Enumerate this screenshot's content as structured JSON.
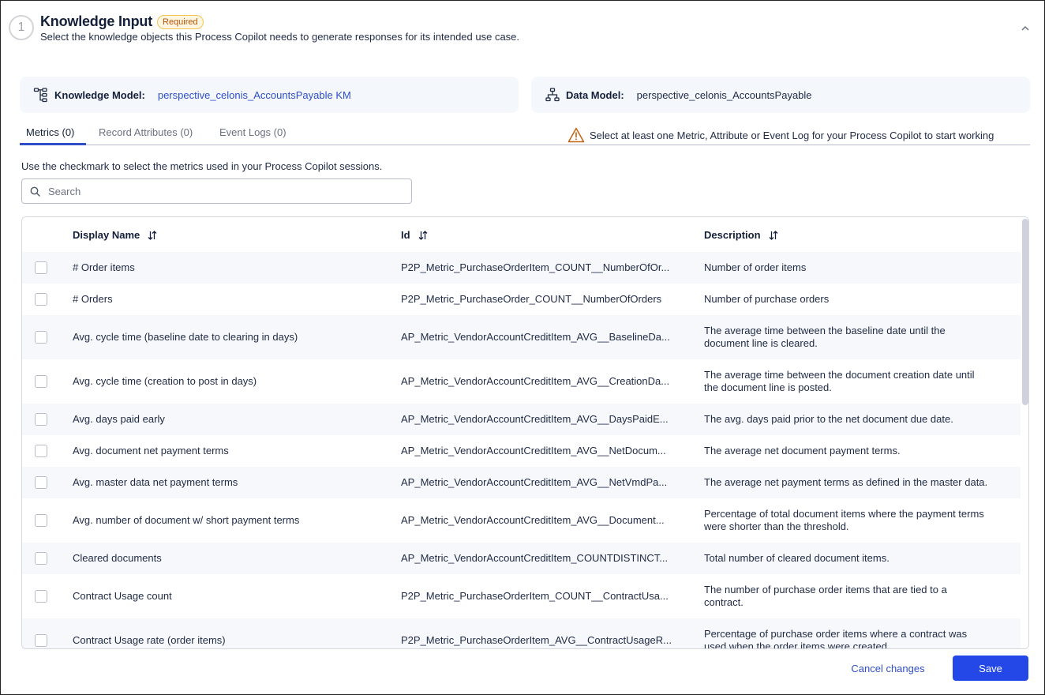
{
  "header": {
    "step_number": "1",
    "title": "Knowledge Input",
    "badge": "Required",
    "subtitle": "Select the knowledge objects this Process Copilot needs to generate responses for its intended use case."
  },
  "knowledge_model": {
    "icon": "hierarchy-tree-icon",
    "label": "Knowledge Model:",
    "value": "perspective_celonis_AccountsPayable KM"
  },
  "data_model": {
    "icon": "sitemap-icon",
    "label": "Data Model:",
    "value": "perspective_celonis_AccountsPayable"
  },
  "tabs": [
    {
      "label": "Metrics (0)",
      "active": true
    },
    {
      "label": "Record Attributes (0)",
      "active": false
    },
    {
      "label": "Event Logs (0)",
      "active": false
    }
  ],
  "warning": {
    "icon": "warning-triangle-icon",
    "text": "Select at least one Metric, Attribute or Event Log for your Process Copilot to start working"
  },
  "instruction": "Use the checkmark to select the metrics used in your Process Copilot sessions.",
  "search": {
    "placeholder": "Search",
    "value": ""
  },
  "table": {
    "columns": [
      "Display Name",
      "Id",
      "Description"
    ],
    "rows": [
      {
        "name": "# Order items",
        "id": "P2P_Metric_PurchaseOrderItem_COUNT__NumberOfOr...",
        "description": [
          "Number of order items"
        ],
        "checked": false
      },
      {
        "name": "# Orders",
        "id": "P2P_Metric_PurchaseOrder_COUNT__NumberOfOrders",
        "description": [
          "Number of purchase orders"
        ],
        "checked": false
      },
      {
        "name": "Avg. cycle time (baseline date to clearing in days)",
        "id": "AP_Metric_VendorAccountCreditItem_AVG__BaselineDa...",
        "description": [
          "The average time between the baseline date until the",
          "document line is cleared."
        ],
        "checked": false
      },
      {
        "name": "Avg. cycle time (creation to post in days)",
        "id": "AP_Metric_VendorAccountCreditItem_AVG__CreationDa...",
        "description": [
          "The average time between the document creation date until",
          "the document line is posted."
        ],
        "checked": false
      },
      {
        "name": "Avg. days paid early",
        "id": "AP_Metric_VendorAccountCreditItem_AVG__DaysPaidE...",
        "description": [
          "The avg. days paid prior to the net document due date."
        ],
        "checked": false
      },
      {
        "name": "Avg. document net payment terms",
        "id": "AP_Metric_VendorAccountCreditItem_AVG__NetDocum...",
        "description": [
          "The average net document payment terms."
        ],
        "checked": false
      },
      {
        "name": "Avg. master data net payment terms",
        "id": "AP_Metric_VendorAccountCreditItem_AVG__NetVmdPa...",
        "description": [
          "The average net payment terms as defined in the master data."
        ],
        "checked": false
      },
      {
        "name": "Avg. number of document w/ short payment terms",
        "id": "AP_Metric_VendorAccountCreditItem_AVG__Document...",
        "description": [
          "Percentage of total document items where the payment terms",
          "were shorter than the threshold."
        ],
        "checked": false
      },
      {
        "name": "Cleared documents",
        "id": "AP_Metric_VendorAccountCreditItem_COUNTDISTINCT...",
        "description": [
          "Total number of cleared document items."
        ],
        "checked": false
      },
      {
        "name": "Contract Usage count",
        "id": "P2P_Metric_PurchaseOrderItem_COUNT__ContractUsa...",
        "description": [
          "The number of purchase order items that are tied to a",
          "contract."
        ],
        "checked": false
      },
      {
        "name": "Contract Usage rate (order items)",
        "id": "P2P_Metric_PurchaseOrderItem_AVG__ContractUsageR...",
        "description": [
          "Percentage of purchase order items where a contract was",
          "used when the order items were created."
        ],
        "checked": false
      }
    ]
  },
  "footer": {
    "cancel_label": "Cancel changes",
    "save_label": "Save"
  },
  "colors": {
    "accent": "#2448e8",
    "link": "#2f4ec7",
    "warning": "#c2620f",
    "badge_text": "#b45309",
    "badge_bg": "#fef6e0"
  }
}
